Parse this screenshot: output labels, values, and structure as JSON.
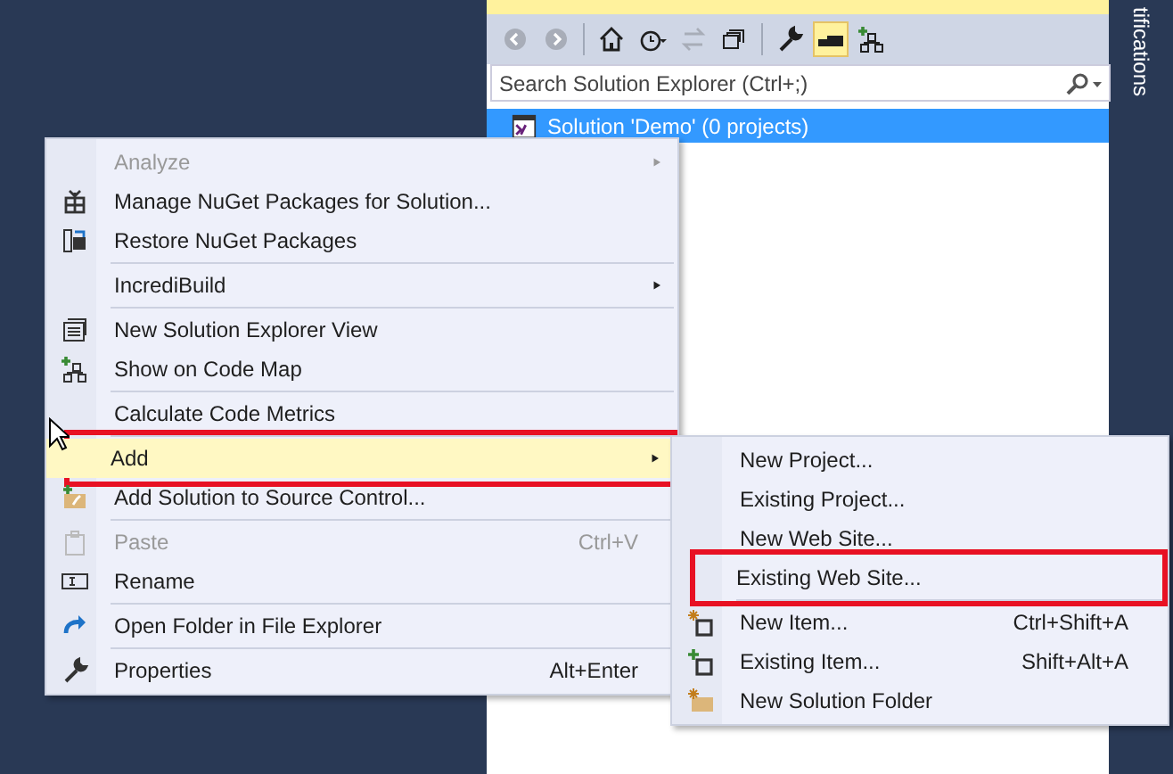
{
  "solution_explorer": {
    "toolbar": [
      {
        "disabled": true,
        "pressed": false
      },
      {
        "disabled": true,
        "pressed": false
      },
      {
        "disabled": false,
        "pressed": false
      },
      {
        "disabled": false,
        "pressed": false
      },
      {
        "disabled": true,
        "pressed": false
      },
      {
        "disabled": false,
        "pressed": false
      },
      {
        "disabled": false,
        "pressed": false
      },
      {
        "disabled": false,
        "pressed": true
      },
      {
        "disabled": false,
        "pressed": false
      }
    ],
    "search": {
      "placeholder": "Search Solution Explorer (Ctrl+;)"
    },
    "tree": [
      {
        "label": "Solution 'Demo' (0 projects)",
        "selected": true
      }
    ]
  },
  "side_tab": {
    "label": "tifications"
  },
  "context_menu": {
    "items": [
      {
        "kind": "item",
        "label": "Analyze",
        "disabled": true,
        "submenu": true,
        "selected": false,
        "highlighted": false
      },
      {
        "kind": "item",
        "label": "Manage NuGet Packages for Solution...",
        "disabled": false,
        "submenu": false,
        "selected": false,
        "highlighted": false
      },
      {
        "kind": "item",
        "label": "Restore NuGet Packages",
        "disabled": false,
        "submenu": false,
        "selected": false,
        "highlighted": false
      },
      {
        "kind": "separator"
      },
      {
        "kind": "item",
        "label": "IncrediBuild",
        "disabled": false,
        "submenu": true,
        "selected": false,
        "highlighted": false
      },
      {
        "kind": "separator"
      },
      {
        "kind": "item",
        "label": "New Solution Explorer View",
        "disabled": false,
        "submenu": false,
        "selected": false,
        "highlighted": false
      },
      {
        "kind": "item",
        "label": "Show on Code Map",
        "disabled": false,
        "submenu": false,
        "selected": false,
        "highlighted": false
      },
      {
        "kind": "separator"
      },
      {
        "kind": "item",
        "label": "Calculate Code Metrics",
        "disabled": false,
        "submenu": false,
        "selected": false,
        "highlighted": false
      },
      {
        "kind": "separator"
      },
      {
        "kind": "item",
        "label": "Add",
        "disabled": false,
        "submenu": true,
        "selected": true,
        "highlighted": true
      },
      {
        "kind": "item",
        "label": "Add Solution to Source Control...",
        "disabled": false,
        "submenu": false,
        "selected": false,
        "highlighted": false
      },
      {
        "kind": "separator"
      },
      {
        "kind": "item",
        "label": "Paste",
        "shortcut": "Ctrl+V",
        "disabled": true,
        "submenu": false,
        "selected": false,
        "highlighted": false
      },
      {
        "kind": "item",
        "label": "Rename",
        "disabled": false,
        "submenu": false,
        "selected": false,
        "highlighted": false
      },
      {
        "kind": "separator"
      },
      {
        "kind": "item",
        "label": "Open Folder in File Explorer",
        "disabled": false,
        "submenu": false,
        "selected": false,
        "highlighted": false
      },
      {
        "kind": "separator"
      },
      {
        "kind": "item",
        "label": "Properties",
        "shortcut": "Alt+Enter",
        "disabled": false,
        "submenu": false,
        "selected": false,
        "highlighted": false
      }
    ]
  },
  "add_submenu": {
    "items": [
      {
        "kind": "item",
        "label": "New Project...",
        "disabled": false,
        "selected": false,
        "highlighted": false
      },
      {
        "kind": "item",
        "label": "Existing Project...",
        "disabled": false,
        "selected": false,
        "highlighted": false
      },
      {
        "kind": "item",
        "label": "New Web Site...",
        "disabled": false,
        "selected": false,
        "highlighted": false
      },
      {
        "kind": "item",
        "label": "Existing Web Site...",
        "disabled": false,
        "selected": false,
        "highlighted": true
      },
      {
        "kind": "separator"
      },
      {
        "kind": "item",
        "label": "New Item...",
        "shortcut": "Ctrl+Shift+A",
        "disabled": false,
        "selected": false,
        "highlighted": false
      },
      {
        "kind": "item",
        "label": "Existing Item...",
        "shortcut": "Shift+Alt+A",
        "disabled": false,
        "selected": false,
        "highlighted": false
      },
      {
        "kind": "item",
        "label": "New Solution Folder",
        "disabled": false,
        "selected": false,
        "highlighted": false
      }
    ]
  }
}
